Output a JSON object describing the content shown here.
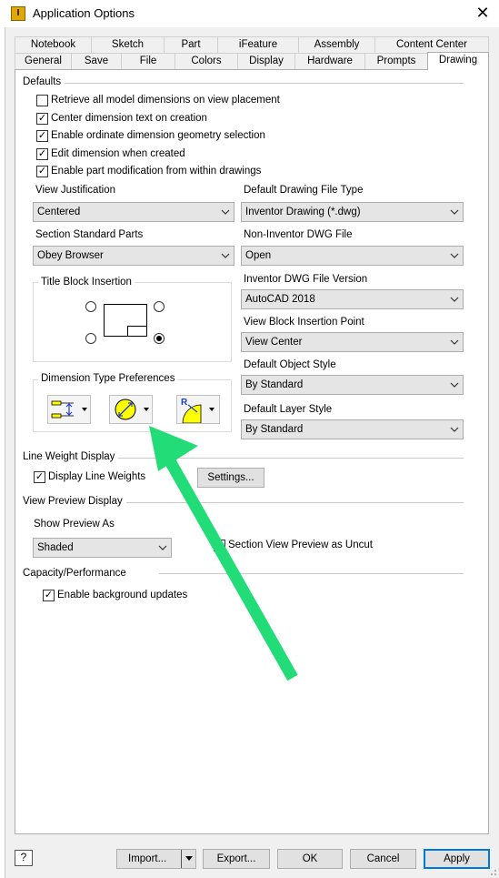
{
  "window": {
    "title": "Application Options",
    "app_icon_glyph": "I"
  },
  "tabs_row1": [
    "Notebook",
    "Sketch",
    "Part",
    "iFeature",
    "Assembly",
    "Content Center"
  ],
  "tabs_row2": [
    "General",
    "Save",
    "File",
    "Colors",
    "Display",
    "Hardware",
    "Prompts",
    "Drawing"
  ],
  "active_tab": "Drawing",
  "defaults": {
    "label": "Defaults",
    "checkboxes": [
      {
        "label": "Retrieve all model dimensions on view placement",
        "checked": false
      },
      {
        "label": "Center dimension text on creation",
        "checked": true
      },
      {
        "label": "Enable ordinate dimension geometry selection",
        "checked": true
      },
      {
        "label": "Edit dimension when created",
        "checked": true
      },
      {
        "label": "Enable part modification from within drawings",
        "checked": true
      }
    ],
    "view_justification": {
      "label": "View Justification",
      "value": "Centered"
    },
    "section_standard_parts": {
      "label": "Section Standard Parts",
      "value": "Obey Browser"
    },
    "default_drawing_file_type": {
      "label": "Default Drawing File Type",
      "value": "Inventor Drawing (*.dwg)"
    },
    "non_inventor_dwg_file": {
      "label": "Non-Inventor DWG File",
      "value": "Open"
    },
    "inventor_dwg_file_version": {
      "label": "Inventor DWG File Version",
      "value": "AutoCAD 2018"
    },
    "view_block_insertion_point": {
      "label": "View Block Insertion Point",
      "value": "View Center"
    },
    "default_object_style": {
      "label": "Default Object Style",
      "value": "By Standard"
    },
    "default_layer_style": {
      "label": "Default Layer Style",
      "value": "By Standard"
    },
    "title_block_insertion": {
      "label": "Title Block Insertion",
      "selected": "bottom-right"
    },
    "dimension_type_preferences": {
      "label": "Dimension Type Preferences",
      "radius_glyph": "R"
    }
  },
  "line_weight_display": {
    "label": "Line Weight Display",
    "display_line_weights": {
      "label": "Display Line Weights",
      "checked": true
    },
    "settings_button": "Settings..."
  },
  "view_preview_display": {
    "label": "View Preview Display",
    "show_preview_as": {
      "label": "Show Preview As",
      "value": "Shaded"
    },
    "section_view_preview_as_uncut": {
      "label": "Section View Preview as Uncut",
      "checked": false
    }
  },
  "capacity_performance": {
    "label": "Capacity/Performance",
    "enable_background_updates": {
      "label": "Enable background updates",
      "checked": true
    }
  },
  "buttons": {
    "help": "?",
    "import": "Import...",
    "export": "Export...",
    "ok": "OK",
    "cancel": "Cancel",
    "apply": "Apply"
  },
  "colors": {
    "annotation_arrow": "#22dd77",
    "accent_blue": "#0078d7",
    "icon_yellow": "#ffff00"
  }
}
